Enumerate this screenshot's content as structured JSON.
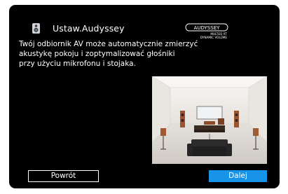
{
  "header": {
    "icon": "speaker-mic-icon",
    "title": "Ustaw.Audyssey"
  },
  "logo": {
    "brand": "AUDYSSEY",
    "line1": "MULTEQ XT",
    "line2": "DYNAMIC VOLUME"
  },
  "description": {
    "line1": "Twój odbiornik AV może automatycznie zmierzyć",
    "line2": "akustykę pokoju i zoptymalizować głośniki",
    "line3": "przy użyciu mikrofonu i stojaka."
  },
  "buttons": {
    "back_label": "Powrót",
    "next_label": "Dalej"
  },
  "colors": {
    "background": "#000000",
    "accent": "#1793e8",
    "text": "#ffffff"
  }
}
